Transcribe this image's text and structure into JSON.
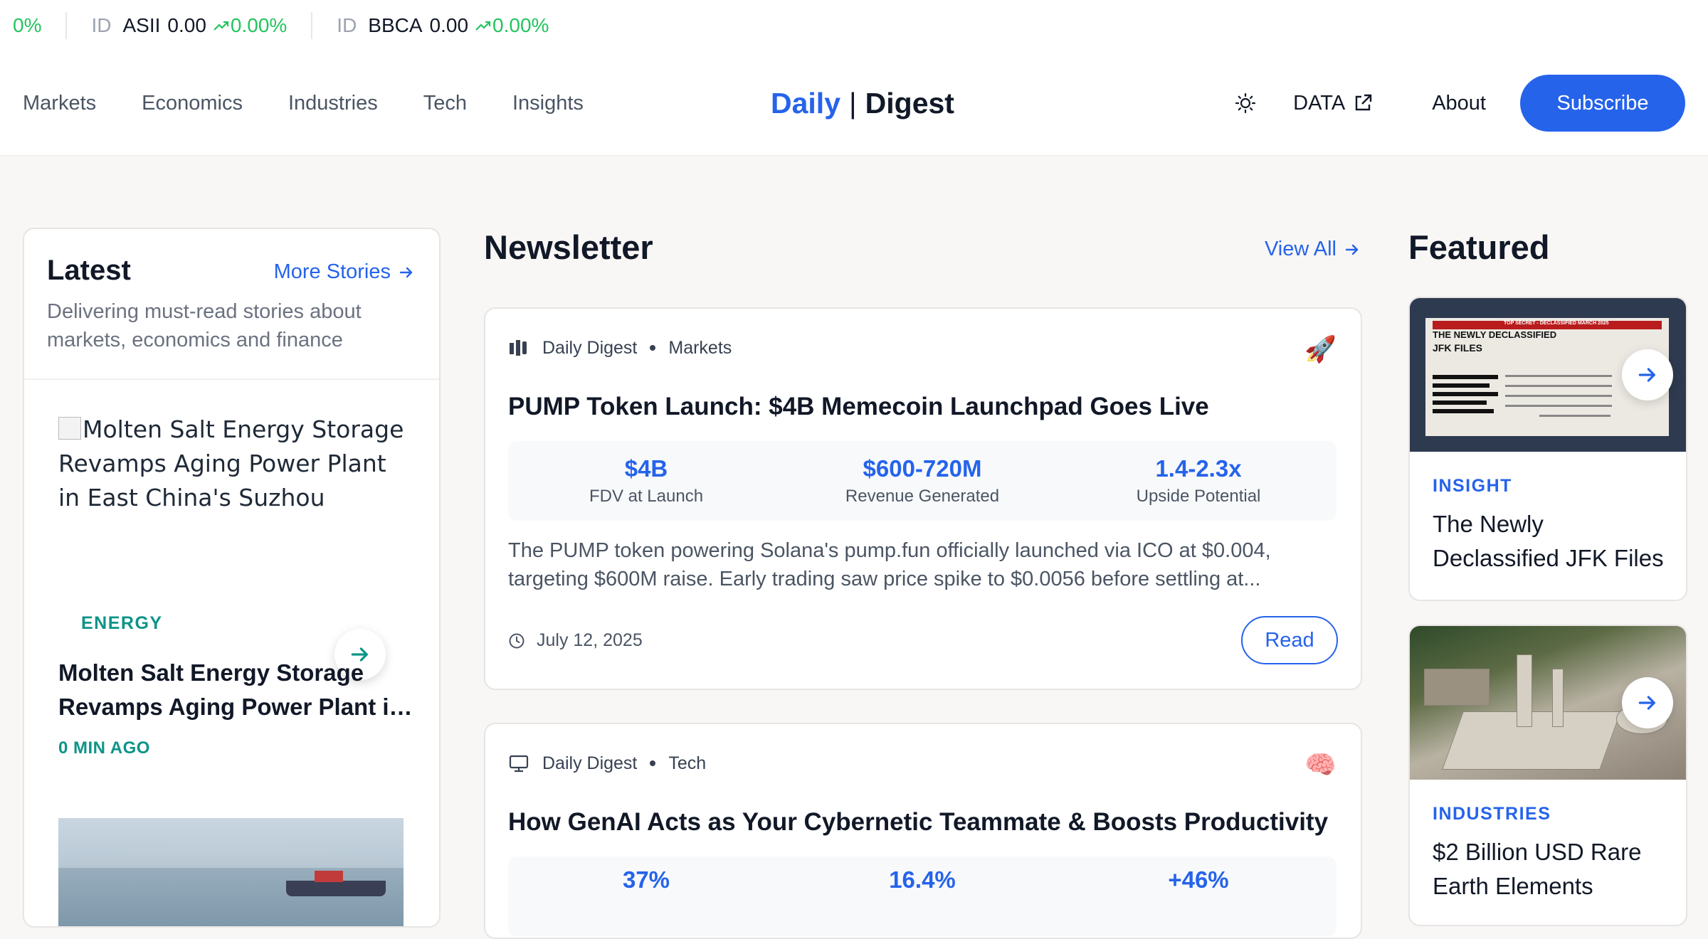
{
  "ticker": {
    "partial_change": "0%",
    "items": [
      {
        "exchange": "ID",
        "symbol": "ASII",
        "price": "0.00",
        "change": "0.00%"
      },
      {
        "exchange": "ID",
        "symbol": "BBCA",
        "price": "0.00",
        "change": "0.00%"
      }
    ],
    "up_color": "#22c55e"
  },
  "header": {
    "nav": [
      "Markets",
      "Economics",
      "Industries",
      "Tech",
      "Insights"
    ],
    "logo_part1": "Daily",
    "logo_separator": "|",
    "logo_part2": "Digest",
    "theme_icon": "sun-icon",
    "data_label": "DATA",
    "about_label": "About",
    "subscribe_label": "Subscribe",
    "accent_color": "#2563eb"
  },
  "latest": {
    "title": "Latest",
    "more_label": "More Stories",
    "description": "Delivering must-read stories about markets, economics and finance",
    "story": {
      "image_alt": "Molten Salt Energy Storage Revamps Aging Power Plant in East China's Suzhou",
      "category": "ENERGY",
      "title_line1": "Molten Salt Energy Storage",
      "title_line2": "Revamps Aging Power Plant in East China's Suzhou",
      "time": "0 MIN AGO"
    }
  },
  "newsletter": {
    "title": "Newsletter",
    "view_all_label": "View All",
    "cards": [
      {
        "source": "Daily Digest",
        "section": "Markets",
        "emoji": "🚀",
        "title": "PUMP Token Launch: $4B Memecoin Launchpad Goes Live",
        "stats": [
          {
            "value": "$4B",
            "label": "FDV at Launch"
          },
          {
            "value": "$600-720M",
            "label": "Revenue Generated"
          },
          {
            "value": "1.4-2.3x",
            "label": "Upside Potential"
          }
        ],
        "summary_line1": "The PUMP token powering Solana's pump.fun officially launched via ICO at $0.004,",
        "summary_line2": "targeting $600M raise. Early trading saw price spike to $0.0056 before settling at...",
        "date": "July 12, 2025",
        "read_label": "Read"
      },
      {
        "source": "Daily Digest",
        "section": "Tech",
        "emoji": "🧠",
        "title": "How GenAI Acts as Your Cybernetic Teammate & Boosts Productivity",
        "stats": [
          {
            "value": "37%",
            "label": ""
          },
          {
            "value": "16.4%",
            "label": ""
          },
          {
            "value": "+46%",
            "label": ""
          }
        ]
      }
    ]
  },
  "featured": {
    "title": "Featured",
    "items": [
      {
        "category": "INSIGHT",
        "title_line1": "The Newly",
        "title_line2": "Declassified JFK Files",
        "image_text_banner": "TOP SECRET - DECLASSIFIED MARCH 2025",
        "image_text_head1": "THE NEWLY DECLASSIFIED",
        "image_text_head2": "JFK FILES"
      },
      {
        "category": "INDUSTRIES",
        "title_line1": "$2 Billion USD Rare",
        "title_line2": "Earth Elements"
      }
    ]
  }
}
